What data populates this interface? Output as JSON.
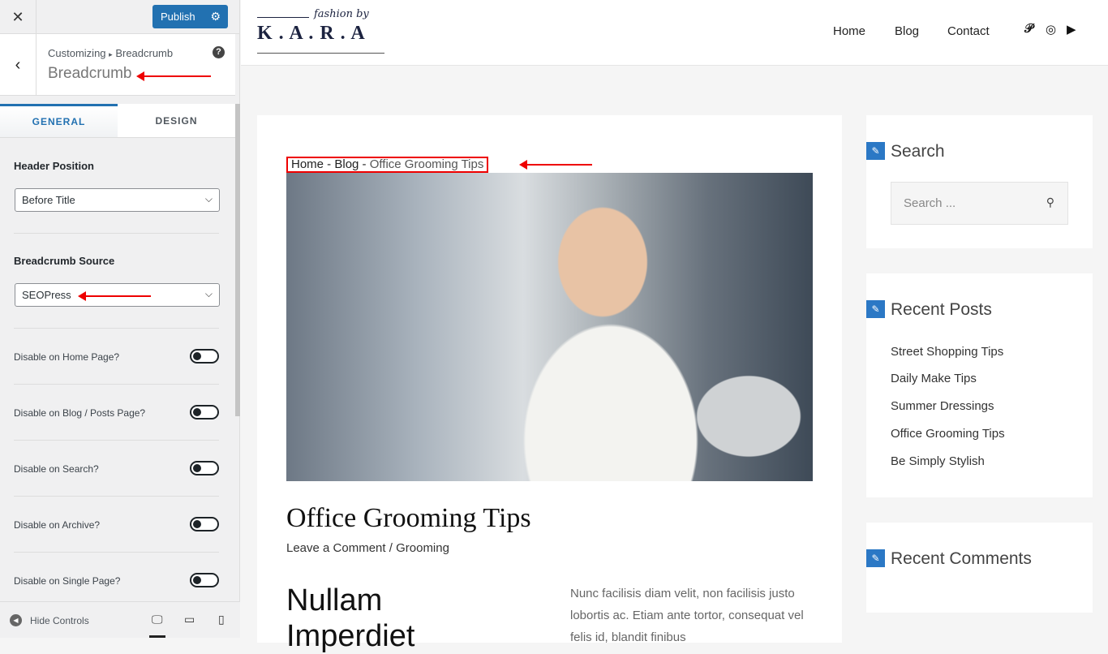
{
  "customizer": {
    "close_icon": "close-icon",
    "publish_label": "Publish",
    "breadcrumb_root": "Customizing",
    "breadcrumb_sep": "▸",
    "breadcrumb_current": "Breadcrumb",
    "section_title": "Breadcrumb",
    "help": "?",
    "tabs": [
      {
        "label": "GENERAL",
        "active": true
      },
      {
        "label": "DESIGN",
        "active": false
      }
    ],
    "header_position": {
      "label": "Header Position",
      "value": "Before Title"
    },
    "breadcrumb_source": {
      "label": "Breadcrumb Source",
      "value": "SEOPress"
    },
    "toggles": [
      {
        "label": "Disable on Home Page?",
        "on": false
      },
      {
        "label": "Disable on Blog / Posts Page?",
        "on": false
      },
      {
        "label": "Disable on Search?",
        "on": false
      },
      {
        "label": "Disable on Archive?",
        "on": false
      },
      {
        "label": "Disable on Single Page?",
        "on": false
      }
    ],
    "hide_controls": "Hide Controls",
    "accent": "#2271b1"
  },
  "site": {
    "logo": {
      "script": "fashion by",
      "name": "K . A . R . A"
    },
    "nav": [
      "Home",
      "Blog",
      "Contact"
    ],
    "breadcrumb": {
      "home": "Home",
      "sep": " - ",
      "blog": "Blog",
      "current": "Office Grooming Tips"
    },
    "post_title": "Office Grooming Tips",
    "meta_comment": "Leave a Comment",
    "meta_sep": " / ",
    "meta_category": "Grooming",
    "heading": "Nullam Imperdiet",
    "paragraph": "Nunc facilisis diam velit, non facilisis justo lobortis ac. Etiam ante tortor, consequat vel felis id, blandit finibus",
    "widgets": {
      "search_title": "Search",
      "search_placeholder": "Search ...",
      "recent_posts_title": "Recent Posts",
      "recent_posts": [
        "Street Shopping Tips",
        "Daily Make Tips",
        "Summer Dressings",
        "Office Grooming Tips",
        "Be Simply Stylish"
      ],
      "recent_comments_title": "Recent Comments"
    },
    "annotation_color": "#e00000"
  }
}
